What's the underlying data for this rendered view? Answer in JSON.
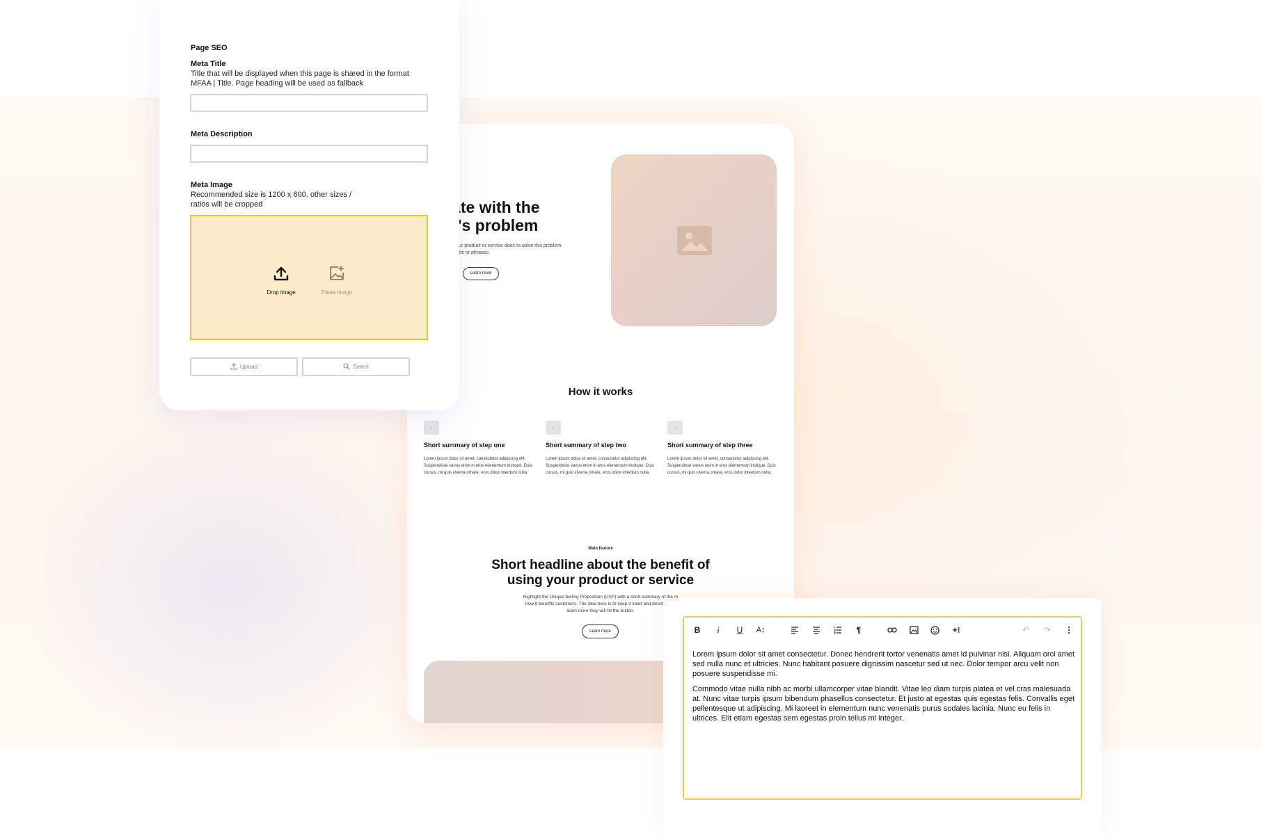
{
  "seo": {
    "heading": "Page SEO",
    "meta_title": {
      "label": "Meta Title",
      "help_line1": "Title that will be displayed when this page is shared in the format",
      "help_line2": "MFAA | Title. Page heading will be used as fallback",
      "value": ""
    },
    "meta_description": {
      "label": "Meta Description",
      "value": ""
    },
    "meta_image": {
      "label": "Meta Image",
      "help_line1": "Recommended size is 1200 x 600, other sizes /",
      "help_line2": "ratios will be cropped",
      "drop_label": "Drop image",
      "paste_label": "Paste image"
    },
    "upload_label": "Upload",
    "select_label": "Select"
  },
  "preview": {
    "hero_title_line1": "nate with the",
    "hero_title_line2": "or's problem",
    "hero_body_line1": "what your product or service does to solve this problem.",
    "hero_body_line2": "ose words or phrases.",
    "hero_button": "Learn more",
    "how_title": "How it works",
    "steps": [
      {
        "title": "Short summary of step one",
        "body": "Lorem ipsum dolor sit amet, consectetur adipiscing elit. Suspendisse varius enim in eros elementum tristique. Duis cursus, mi quis viverra ornare, eros dolor interdum nulla."
      },
      {
        "title": "Short summary of step two",
        "body": "Lorem ipsum dolor sit amet, consectetur adipiscing elit. Suspendisse varius enim in eros elementum tristique. Duis cursus, mi quis viverra ornare, eros dolor interdum nulla."
      },
      {
        "title": "Short summary of step three",
        "body": "Lorem ipsum dolor sit amet, consectetur adipiscing elit. Suspendisse varius enim in eros elementum tristique. Duis cursus, mi quis viverra ornare, eros dolor interdum nulla."
      }
    ],
    "feature_eyebrow": "Main feature",
    "feature_title_line1": "Short headline about the benefit of",
    "feature_title_line2": "using your product or service",
    "feature_body_line1": "Highlight the Unique Selling Proposition (USP) with a short summary of the m",
    "feature_body_line2": "how it benefits customers. The idea here is to keep it short and direct. If the",
    "feature_body_line3": "learn more they will hit the button.",
    "feature_button": "Learn more"
  },
  "editor": {
    "toolbar": {
      "bold": "B",
      "italic": "i",
      "underline": "U",
      "text_size": "A↕"
    },
    "paragraph1": "Lorem ipsum dolor sit amet consectetur. Donec hendrerit tortor venenatis amet id pulvinar nisi. Aliquam orci amet sed nulla nunc et ultricies. Nunc habitant posuere dignissim nascetur sed ut nec. Dolor tempor arcu velit non posuere suspendisse mi.",
    "paragraph2": "Commodo vitae nulla nibh ac morbi ullamcorper vitae blandit. Vitae leo diam turpis platea et vel cras malesuada at. Nunc vitae turpis ipsum bibendum phasellus consectetur. Et justo at egestas quis egestas felis. Convallis eget pellentesque ut adipiscing. Mi laoreet in elementum nunc venenatis purus sodales lacinia. Nunc eu felis in ultrices. Elit etiam egestas sem egestas proin tellus mi integer."
  },
  "colors": {
    "accent_yellow": "#f0c13e",
    "dropzone_fill": "#faeccb",
    "background_peach": "#fff5ee"
  }
}
